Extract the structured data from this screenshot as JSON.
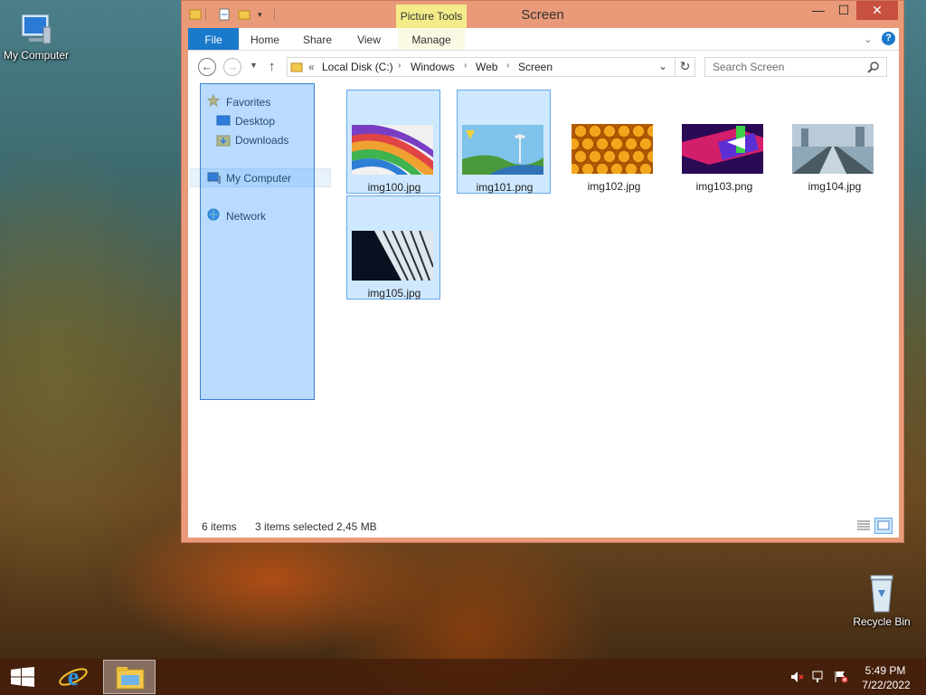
{
  "desktop": {
    "icons": [
      {
        "label": "My Computer"
      },
      {
        "label": "Recycle Bin"
      }
    ]
  },
  "window": {
    "title": "Screen",
    "contextual_tab": "Picture Tools",
    "controls": {
      "minimize": "—",
      "maximize": "☐",
      "close": "✕"
    }
  },
  "ribbon": {
    "tabs": [
      "File",
      "Home",
      "Share",
      "View",
      "Manage"
    ],
    "help": "?"
  },
  "navigation": {
    "back": "←",
    "forward": "→",
    "up": "↑",
    "overflow": "«",
    "breadcrumbs": [
      "Local Disk (C:)",
      "Windows",
      "Web",
      "Screen"
    ],
    "search_placeholder": "Search Screen"
  },
  "nav_pane": {
    "favorites": {
      "label": "Favorites",
      "items": [
        "Desktop",
        "Downloads"
      ]
    },
    "computer": "My Computer",
    "network": "Network"
  },
  "files": [
    {
      "name": "img100.jpg",
      "selected": true,
      "thumb": "rainbow-stripes"
    },
    {
      "name": "img101.png",
      "selected": true,
      "thumb": "space-needle"
    },
    {
      "name": "img102.jpg",
      "selected": false,
      "thumb": "honeycomb"
    },
    {
      "name": "img103.png",
      "selected": false,
      "thumb": "abstract-shapes"
    },
    {
      "name": "img104.jpg",
      "selected": false,
      "thumb": "train-tracks"
    },
    {
      "name": "img105.jpg",
      "selected": true,
      "thumb": "piano-keys"
    }
  ],
  "status": {
    "item_count": "6 items",
    "selection": "3 items selected",
    "size": "2,45 MB"
  },
  "taskbar": {
    "time": "5:49 PM",
    "date": "7/22/2022"
  },
  "colors": {
    "window_frame": "#e99a78",
    "close_button": "#c7503f",
    "file_tab": "#1979ca",
    "selection": "#cde8ff",
    "contextual_tab": "#f4ec8a"
  }
}
